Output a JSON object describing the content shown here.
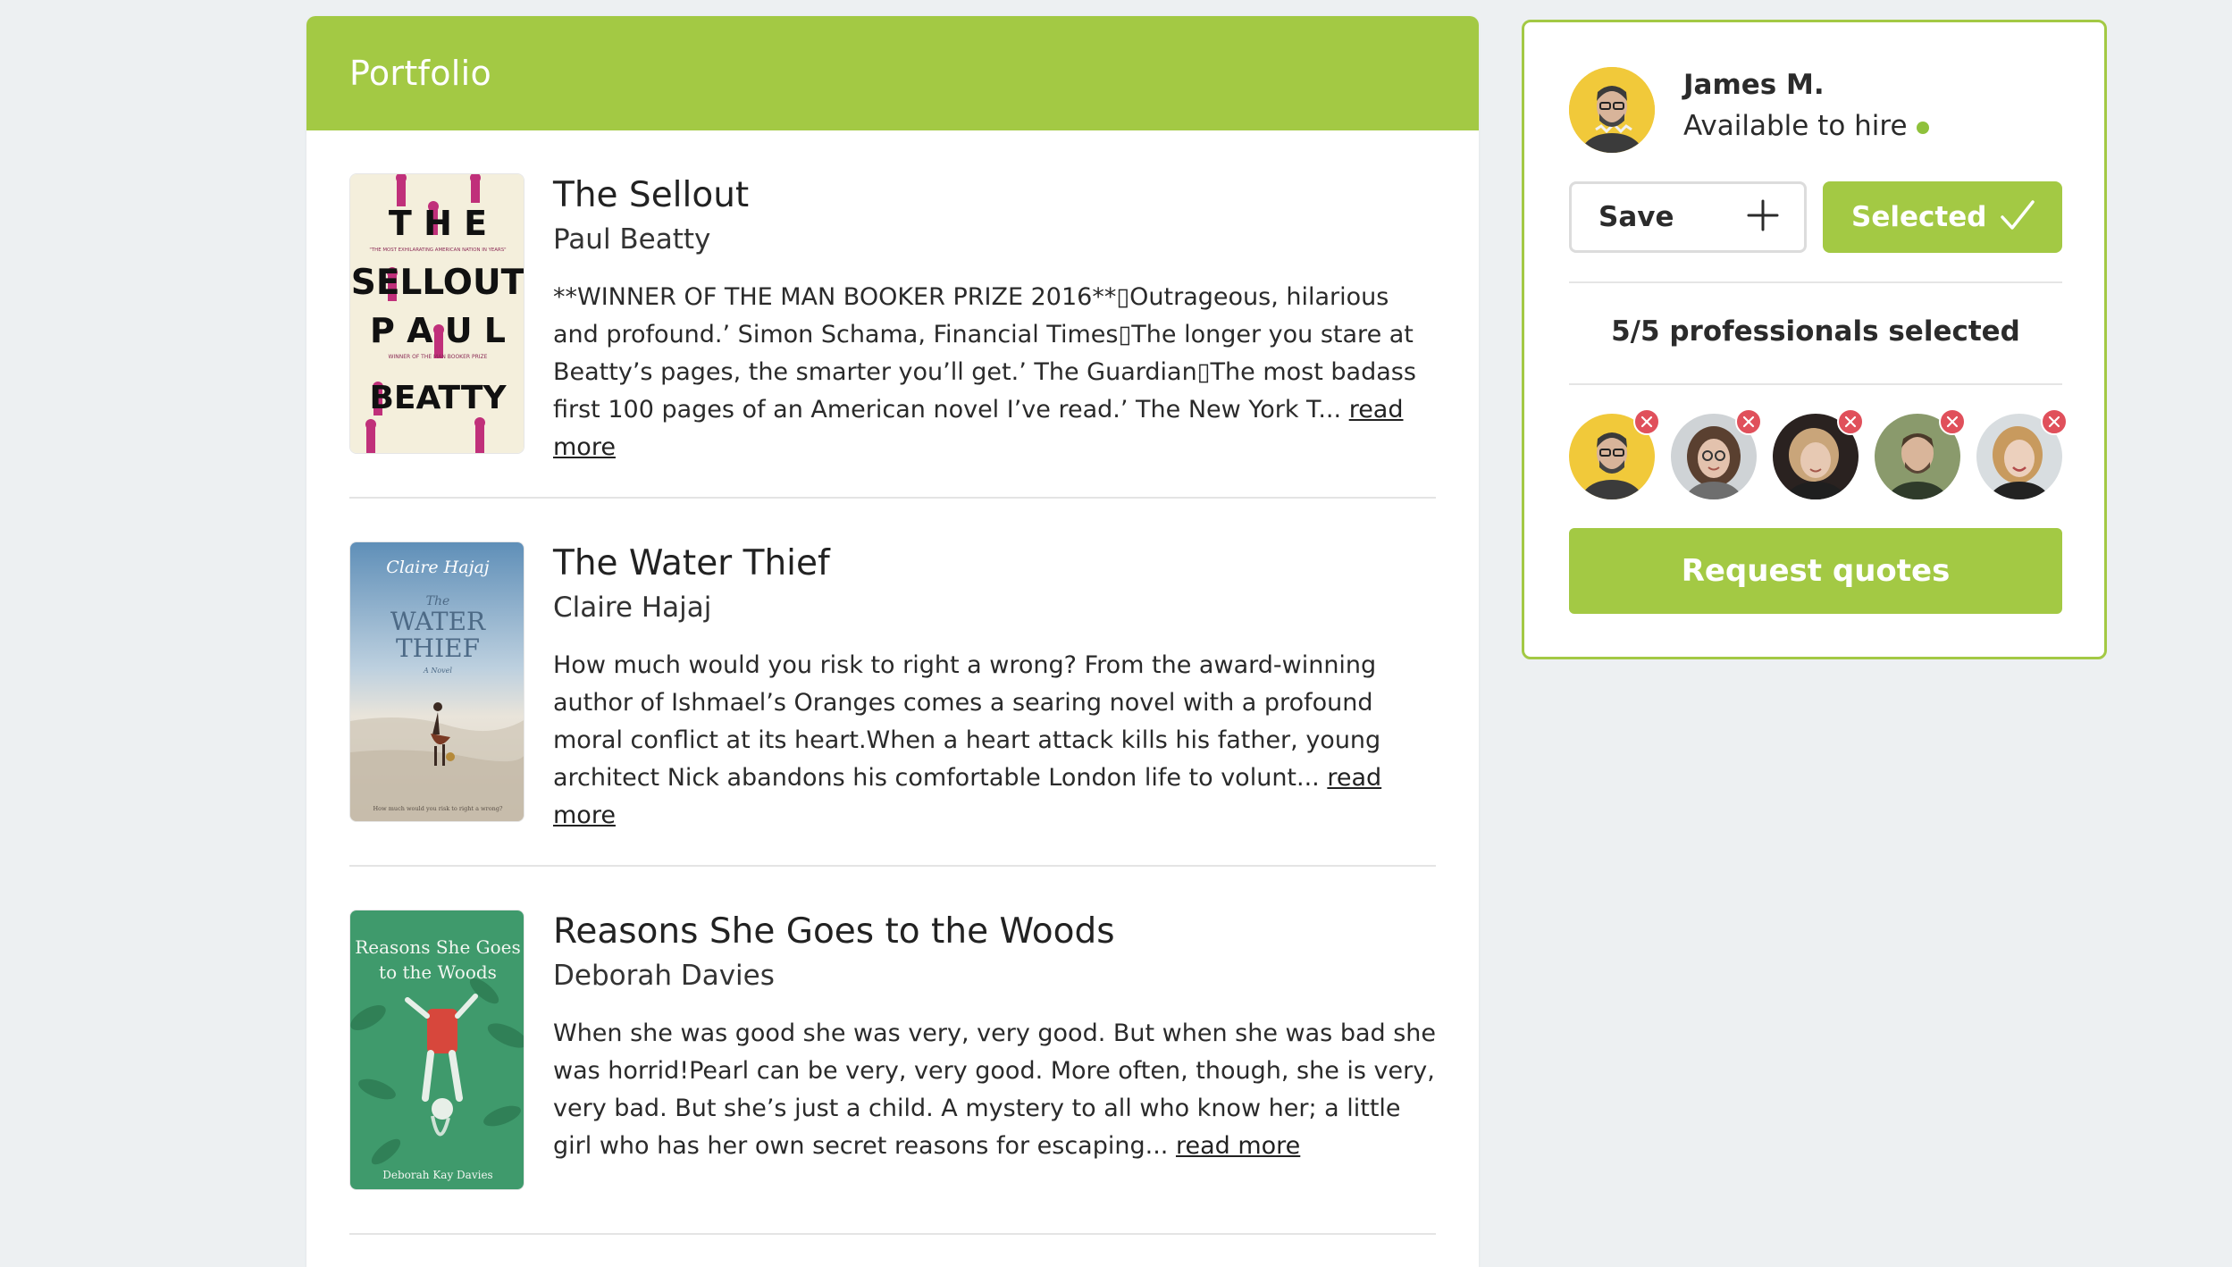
{
  "portfolio": {
    "title": "Portfolio",
    "read_more_label": "read more",
    "books": [
      {
        "title": "The Sellout",
        "author": "Paul Beatty",
        "description": "**WINNER OF THE MAN BOOKER PRIZE 2016**▯Outrageous, hilarious and profound.’ Simon Schama, Financial Times▯The longer you stare at Beatty’s pages, the smarter you’ll get.’ The Guardian▯The most badass first 100 pages of an American novel I’ve read.’ The New York T...",
        "cover": {
          "line1": "T H E",
          "line2": "SELLOUT",
          "line3": "P A U L",
          "line4": "BEATTY",
          "tagline": "\"THE MOST EXHILARATING AMERICAN NATION IN YEARS\"",
          "prize": "WINNER OF THE MAN BOOKER PRIZE",
          "background": "#f4efdc",
          "accent": "#c0307a"
        }
      },
      {
        "title": "The Water Thief",
        "author": "Claire Hajaj",
        "description": "How much would you risk to right a wrong? From the award-winning author of Ishmael’s Oranges comes a searing novel with a profound moral conflict at its heart.When a heart attack kills his father, young architect Nick abandons his comfortable London life to volunt...",
        "cover": {
          "author_script": "Claire Hajaj",
          "the": "The",
          "line1": "WATER",
          "line2": "THIEF",
          "sub": "A Novel",
          "tagline": "How much would you risk to right a wrong?",
          "sky": "#5f8fb8",
          "sand": "#e9e4da"
        }
      },
      {
        "title": "Reasons She Goes to the Woods",
        "author": "Deborah Davies",
        "description": "When she was good she was very, very good. But when she was bad she was horrid!Pearl can be very, very good. More often, though, she is very, very bad. But she’s just a child. A mystery to all who know her; a little girl who has her own secret reasons for escaping...",
        "cover": {
          "line1": "Reasons She Goes",
          "line2": "to the Woods",
          "author": "Deborah Kay Davies",
          "background": "#3f9a6c",
          "dress": "#d7473c"
        }
      }
    ]
  },
  "sidebar": {
    "profile": {
      "name": "James M.",
      "status": "Available to hire"
    },
    "save_label": "Save",
    "selected_label": "Selected",
    "selected_count": "5/5 professionals selected",
    "request_label": "Request quotes",
    "selected_professionals": [
      {
        "avatar_bg": "#f1c93a",
        "hair": "#3a3a3a",
        "skin": "#d8b49a"
      },
      {
        "avatar_bg": "#cfd3d6",
        "hair": "#5a4030",
        "skin": "#e3c2ad"
      },
      {
        "avatar_bg": "#2a2220",
        "hair": "#c9a57a",
        "skin": "#e7c9b3"
      },
      {
        "avatar_bg": "#8a9a6c",
        "hair": "#4b3a2a",
        "skin": "#d9b59a"
      },
      {
        "avatar_bg": "#d8dde0",
        "hair": "#c89a5e",
        "skin": "#ecd0bd"
      }
    ]
  },
  "colors": {
    "brand_green": "#a3c944",
    "status_green": "#8fc13c",
    "remove_red": "#e0505b",
    "page_background": "#edf0f2"
  },
  "icons": {
    "save": "plus-icon",
    "selected": "checkmark-icon",
    "remove": "close-icon",
    "status": "online-dot-icon"
  }
}
